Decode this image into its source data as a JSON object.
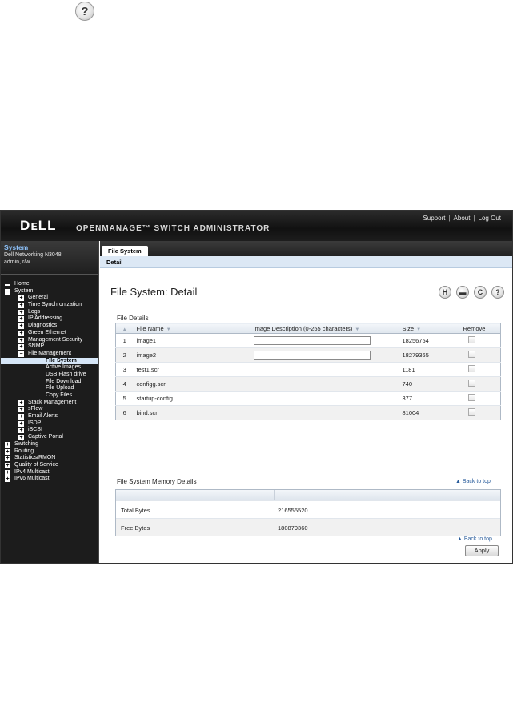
{
  "header": {
    "logo": "DᴇLL",
    "title": "OPENMANAGE™ SWITCH ADMINISTRATOR",
    "links": [
      "Support",
      "About",
      "Log Out"
    ]
  },
  "sidebar": {
    "system_title": "System",
    "device": "Dell Networking N3048",
    "user": "admin, r/w",
    "tree": [
      {
        "label": "Home",
        "level": 0,
        "icon": "dash"
      },
      {
        "label": "System",
        "level": 0,
        "icon": "minus"
      },
      {
        "label": "General",
        "level": 1,
        "icon": "plus"
      },
      {
        "label": "Time Synchronization",
        "level": 1,
        "icon": "plus"
      },
      {
        "label": "Logs",
        "level": 1,
        "icon": "plus"
      },
      {
        "label": "IP Addressing",
        "level": 1,
        "icon": "plus"
      },
      {
        "label": "Diagnostics",
        "level": 1,
        "icon": "plus"
      },
      {
        "label": "Green Ethernet",
        "level": 1,
        "icon": "plus"
      },
      {
        "label": "Management Security",
        "level": 1,
        "icon": "plus"
      },
      {
        "label": "SNMP",
        "level": 1,
        "icon": "plus"
      },
      {
        "label": "File Management",
        "level": 1,
        "icon": "minus"
      },
      {
        "label": "File System",
        "level": 2,
        "icon": "none",
        "selected": true
      },
      {
        "label": "Active Images",
        "level": 2,
        "icon": "none"
      },
      {
        "label": "USB Flash drive",
        "level": 2,
        "icon": "none"
      },
      {
        "label": "File Download",
        "level": 2,
        "icon": "none"
      },
      {
        "label": "File Upload",
        "level": 2,
        "icon": "none"
      },
      {
        "label": "Copy Files",
        "level": 2,
        "icon": "none"
      },
      {
        "label": "Stack Management",
        "level": 1,
        "icon": "plus"
      },
      {
        "label": "sFlow",
        "level": 1,
        "icon": "plus"
      },
      {
        "label": "Email Alerts",
        "level": 1,
        "icon": "plus"
      },
      {
        "label": "ISDP",
        "level": 1,
        "icon": "plus"
      },
      {
        "label": "iSCSI",
        "level": 1,
        "icon": "plus"
      },
      {
        "label": "Captive Portal",
        "level": 1,
        "icon": "plus"
      },
      {
        "label": "Switching",
        "level": 0,
        "icon": "plus"
      },
      {
        "label": "Routing",
        "level": 0,
        "icon": "plus"
      },
      {
        "label": "Statistics/RMON",
        "level": 0,
        "icon": "plus"
      },
      {
        "label": "Quality of Service",
        "level": 0,
        "icon": "plus"
      },
      {
        "label": "IPv4 Multicast",
        "level": 0,
        "icon": "plus"
      },
      {
        "label": "IPv6 Multicast",
        "level": 0,
        "icon": "plus"
      }
    ]
  },
  "main": {
    "tab": "File System",
    "subtab": "Detail",
    "title": "File System: Detail",
    "file_details_label": "File Details",
    "columns": [
      "File Name",
      "Image Description (0-255 characters)",
      "Size",
      "Remove"
    ],
    "files": [
      {
        "index": "1",
        "name": "image1",
        "has_input": true,
        "size": "18256754"
      },
      {
        "index": "2",
        "name": "image2",
        "has_input": true,
        "size": "18279365"
      },
      {
        "index": "3",
        "name": "test1.scr",
        "has_input": false,
        "size": "1181"
      },
      {
        "index": "4",
        "name": "configg.scr",
        "has_input": false,
        "size": "740"
      },
      {
        "index": "5",
        "name": "startup-config",
        "has_input": false,
        "size": "377"
      },
      {
        "index": "6",
        "name": "bind.scr",
        "has_input": false,
        "size": "81004"
      }
    ],
    "memory_label": "File System Memory Details",
    "back_to_top": "Back to top",
    "memory": [
      {
        "label": "Total Bytes",
        "value": "216555520"
      },
      {
        "label": "Free Bytes",
        "value": "180879360"
      }
    ],
    "apply": "Apply"
  }
}
